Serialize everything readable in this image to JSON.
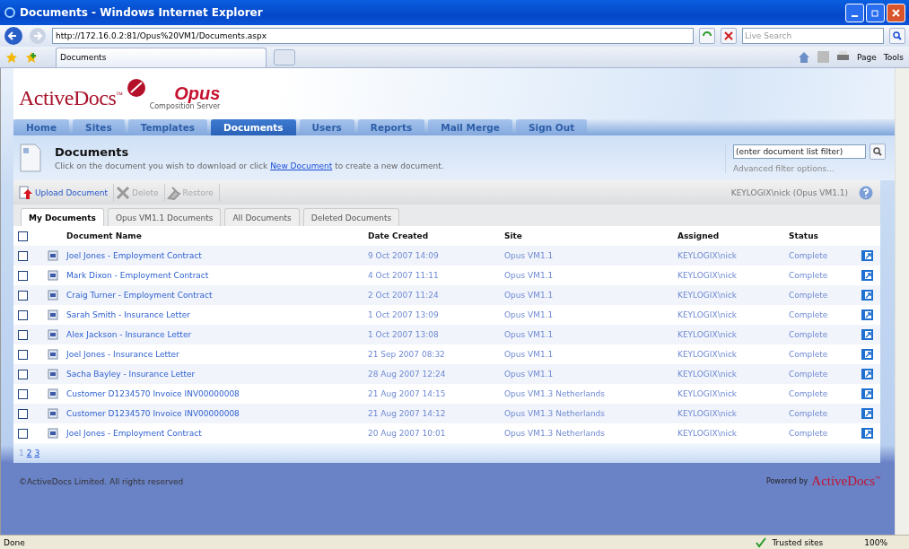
{
  "browser": {
    "title": "Documents - Windows Internet Explorer",
    "address": "http://172.16.0.2:81/Opus%20VM1/Documents.aspx",
    "search_placeholder": "Live Search",
    "tab_title": "Documents",
    "commands": [
      {
        "label": "Page"
      },
      {
        "label": "Tools"
      }
    ],
    "status": "Done",
    "zone": "Trusted sites",
    "zoom": "100%"
  },
  "app": {
    "logo": "ActiveDocs$^{™}$",
    "product": "Opus",
    "subtitle": "Composition Server",
    "nav": [
      {
        "label": "Home",
        "selected": false
      },
      {
        "label": "Sites",
        "selected": false
      },
      {
        "label": "Templates",
        "selected": false
      },
      {
        "label": "Documents",
        "selected": true
      },
      {
        "label": "Users",
        "selected": false
      },
      {
        "label": "Reports",
        "selected": false
      },
      {
        "label": "Mail Merge",
        "selected": false
      },
      {
        "label": "Sign Out",
        "selected": false
      }
    ],
    "page": {
      "title": "Documents",
      "text_before": "Click on the document you wish to download or click",
      "link": "New Document",
      "text_after": "to create a new document."
    },
    "filter": {
      "placeholder": "(enter document list filter)",
      "advanced": "Advanced filter options..."
    },
    "toolbar": {
      "actions": [
        {
          "kind": "upload",
          "label": "Upload Document",
          "disabled": false
        },
        {
          "kind": "delete",
          "label": "Delete",
          "disabled": true
        },
        {
          "kind": "restore",
          "label": "Restore",
          "disabled": true
        }
      ],
      "user": "KEYLOGIX\\nick (Opus VM1.1)"
    },
    "doc_tabs": [
      {
        "label": "My Documents",
        "selected": true
      },
      {
        "label": "Opus VM1.1 Documents",
        "selected": false
      },
      {
        "label": "All Documents",
        "selected": false
      },
      {
        "label": "Deleted Documents",
        "selected": false
      }
    ],
    "select_all_checked": false,
    "columns": [
      "Document Name",
      "Date Created",
      "Site",
      "Assigned",
      "Status"
    ],
    "rows": [
      {
        "name": "Joel Jones - Employment Contract",
        "date": "9 Oct 2007 14:09",
        "site": "Opus VM1.1",
        "assigned": "KEYLOGIX\\nick",
        "status": "Complete",
        "checked": false
      },
      {
        "name": "Mark Dixon - Employment Contract",
        "date": "4 Oct 2007 11:11",
        "site": "Opus VM1.1",
        "assigned": "KEYLOGIX\\nick",
        "status": "Complete",
        "checked": false
      },
      {
        "name": "Craig Turner - Employment Contract",
        "date": "2 Oct 2007 11:24",
        "site": "Opus VM1.1",
        "assigned": "KEYLOGIX\\nick",
        "status": "Complete",
        "checked": false
      },
      {
        "name": "Sarah Smith - Insurance Letter",
        "date": "1 Oct 2007 13:09",
        "site": "Opus VM1.1",
        "assigned": "KEYLOGIX\\nick",
        "status": "Complete",
        "checked": false
      },
      {
        "name": "Alex Jackson - Insurance Letter",
        "date": "1 Oct 2007 13:08",
        "site": "Opus VM1.1",
        "assigned": "KEYLOGIX\\nick",
        "status": "Complete",
        "checked": false
      },
      {
        "name": "Joel Jones - Insurance Letter",
        "date": "21 Sep 2007 08:32",
        "site": "Opus VM1.1",
        "assigned": "KEYLOGIX\\nick",
        "status": "Complete",
        "checked": false
      },
      {
        "name": "Sacha Bayley - Insurance Letter",
        "date": "28 Aug 2007 12:24",
        "site": "Opus VM1.1",
        "assigned": "KEYLOGIX\\nick",
        "status": "Complete",
        "checked": false
      },
      {
        "name": "Customer D1234570 Invoice INV00000008",
        "date": "21 Aug 2007 14:15",
        "site": "Opus VM1.3 Netherlands",
        "assigned": "KEYLOGIX\\nick",
        "status": "Complete",
        "checked": false
      },
      {
        "name": "Customer D1234570 Invoice INV00000008",
        "date": "21 Aug 2007 14:12",
        "site": "Opus VM1.3 Netherlands",
        "assigned": "KEYLOGIX\\nick",
        "status": "Complete",
        "checked": false
      },
      {
        "name": "Joel Jones - Employment Contract",
        "date": "20 Aug 2007 10:01",
        "site": "Opus VM1.3 Netherlands",
        "assigned": "KEYLOGIX\\nick",
        "status": "Complete",
        "checked": false
      }
    ],
    "pages": [
      {
        "label": "1",
        "selected": true
      },
      {
        "label": "2",
        "selected": false
      },
      {
        "label": "3",
        "selected": false
      }
    ],
    "footer": {
      "copyright": "©ActiveDocs Limited. All rights reserved",
      "powered_by": "Powered by",
      "brand": "ActiveDocs$^{™}$"
    }
  }
}
